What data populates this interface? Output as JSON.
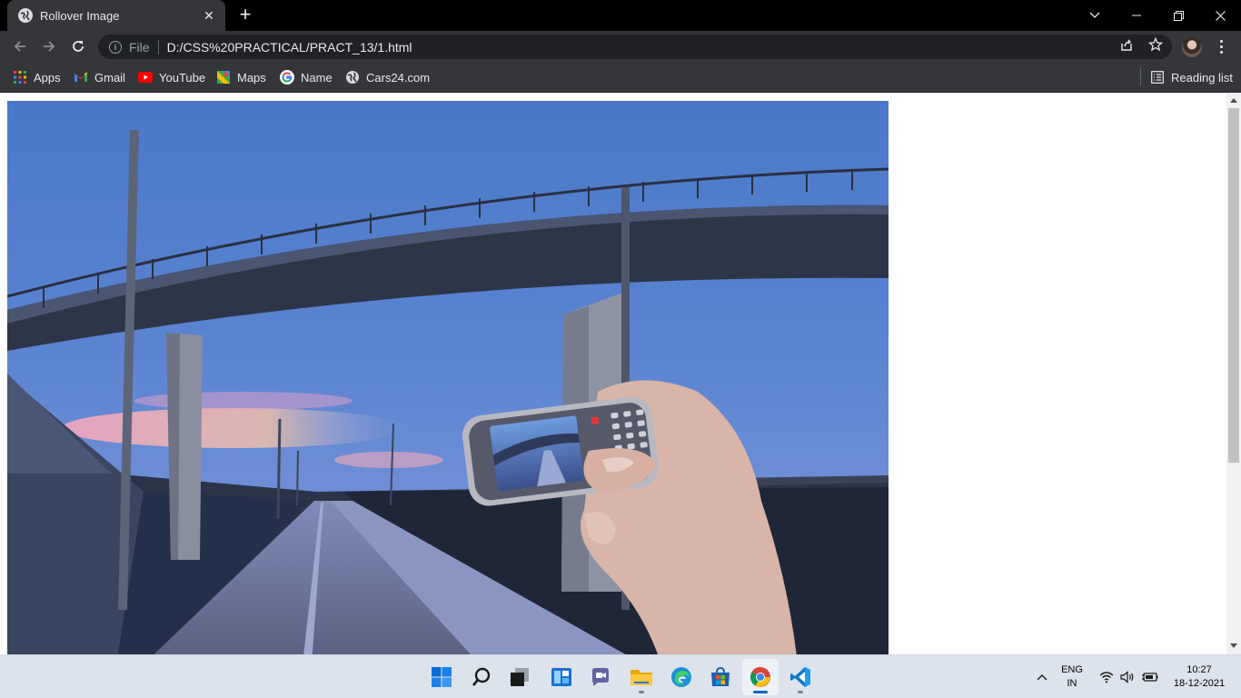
{
  "tab": {
    "title": "Rollover Image",
    "close": "✕",
    "new_tab": "+"
  },
  "window_controls": {
    "minimize": "—",
    "restore": "❐",
    "close": "✕",
    "tab_search": "⌄"
  },
  "omnibox": {
    "scheme_label": "File",
    "url": "D:/CSS%20PRACTICAL/PRACT_13/1.html"
  },
  "bookmarks": [
    {
      "label": "Apps",
      "icon": "apps-grid-icon"
    },
    {
      "label": "Gmail",
      "icon": "gmail-icon"
    },
    {
      "label": "YouTube",
      "icon": "youtube-icon"
    },
    {
      "label": "Maps",
      "icon": "maps-icon"
    },
    {
      "label": "Name",
      "icon": "google-icon"
    },
    {
      "label": "Cars24.com",
      "icon": "globe-icon"
    }
  ],
  "reading_list": {
    "label": "Reading list"
  },
  "page": {
    "image": "photo of a bridge with a hand holding a phone"
  },
  "taskbar": {
    "apps": [
      "start-icon",
      "search-icon",
      "task-view-icon",
      "widgets-icon",
      "chat-icon",
      "file-explorer-icon",
      "edge-icon",
      "store-icon",
      "chrome-icon",
      "vscode-icon"
    ],
    "language": {
      "line1": "ENG",
      "line2": "IN"
    },
    "clock": {
      "time": "10:27",
      "date": "18-12-2021"
    }
  },
  "colors": {
    "chrome_dark": "#35363a",
    "tabstrip": "#000000",
    "omnibox": "#202124",
    "taskbar": "#dde3ec",
    "accent": "#0067c0"
  }
}
